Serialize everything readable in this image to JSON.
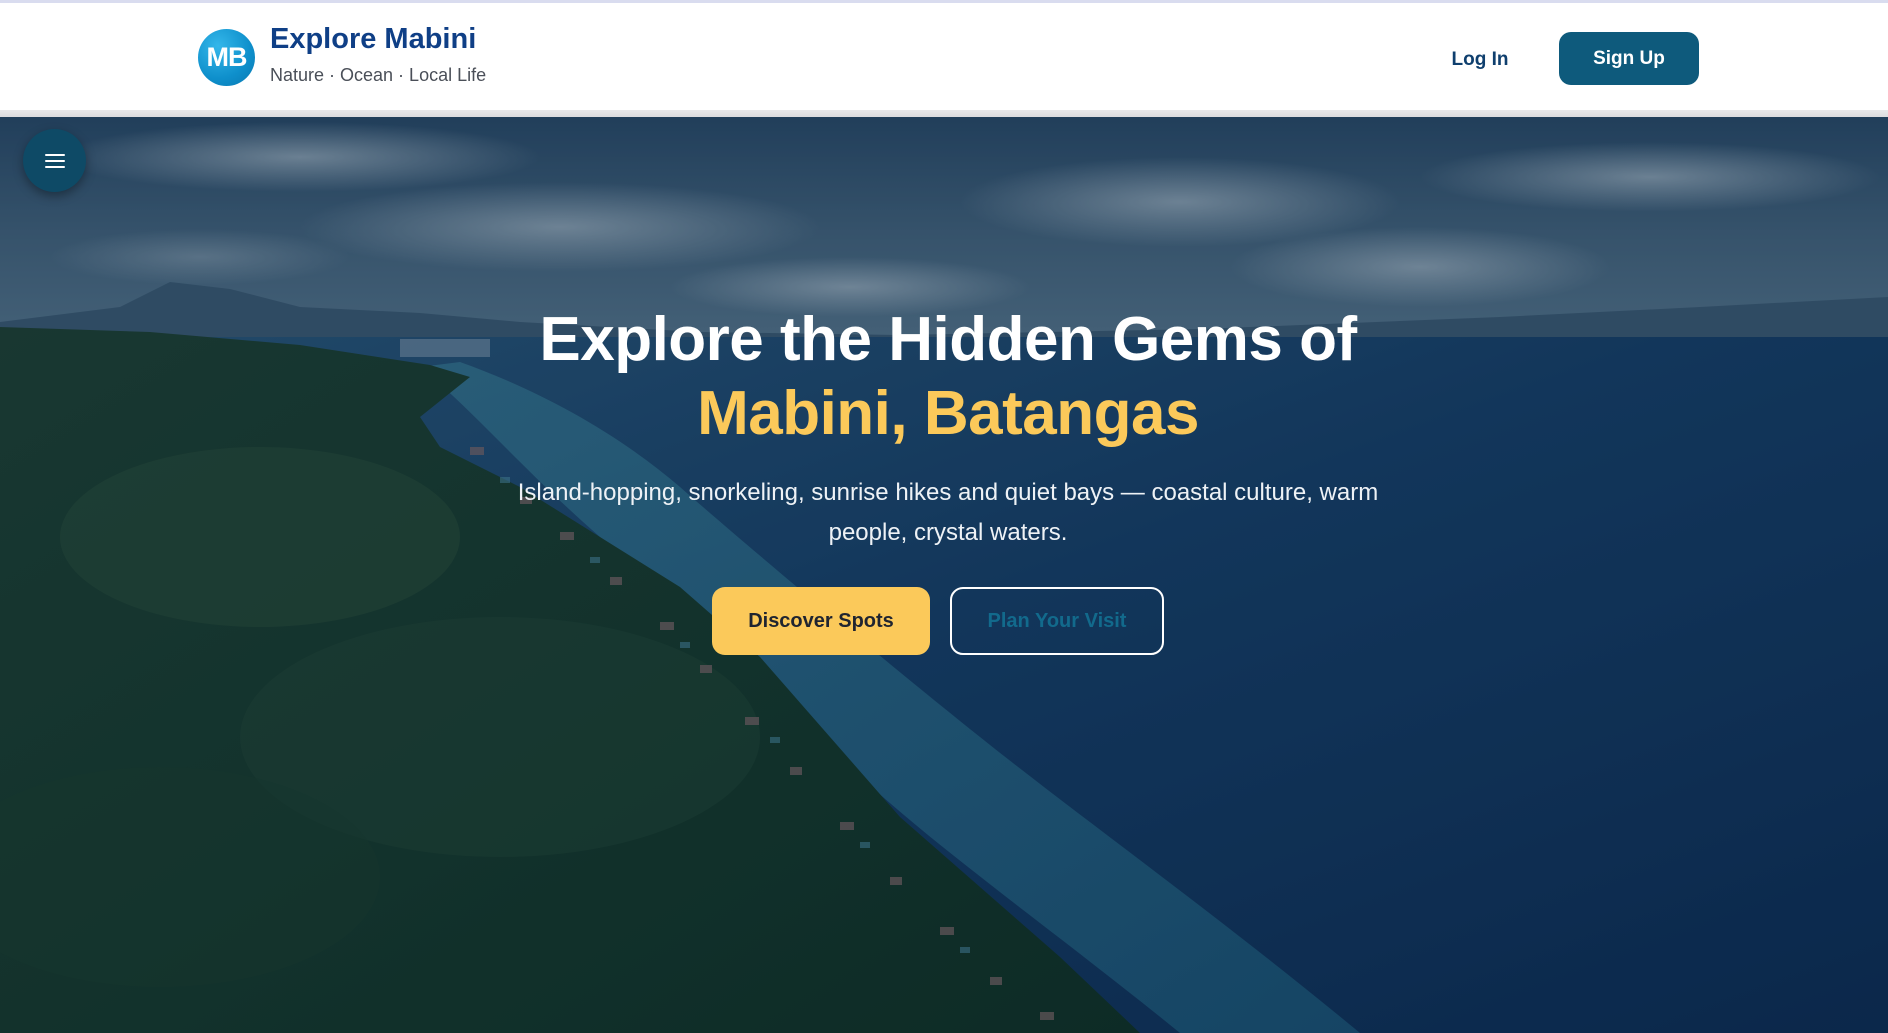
{
  "header": {
    "logo_initials": "MB",
    "brand_title": "Explore Mabini",
    "brand_subtitle": "Nature · Ocean · Local Life",
    "login_label": "Log In",
    "signup_label": "Sign Up"
  },
  "hero": {
    "heading_line1": "Explore the Hidden Gems of",
    "heading_line2": "Mabini, Batangas",
    "description": "Island-hopping, snorkeling, sunrise hikes and quiet bays — coastal culture, warm people, crystal waters.",
    "primary_button": "Discover Spots",
    "secondary_button": "Plan Your Visit",
    "menu_icon": "hamburger-menu-icon"
  },
  "colors": {
    "brand_blue": "#0f3f86",
    "signup_bg": "#0e5a7c",
    "accent_yellow": "#fbc95a",
    "menu_bg": "#0e4a66"
  }
}
